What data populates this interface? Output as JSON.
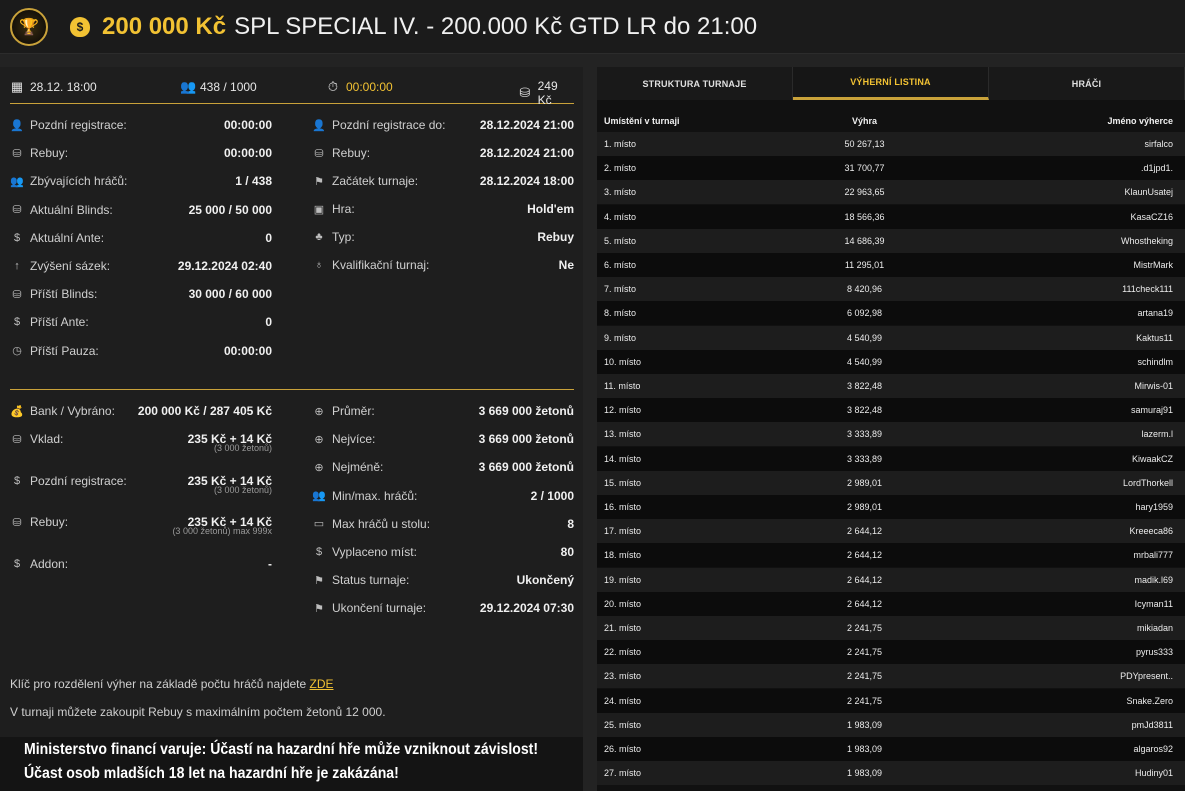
{
  "header": {
    "amount": "200 000 Kč",
    "title": "SPL SPECIAL IV. - 200.000 Kč GTD LR do 21:00",
    "moneybag_icon": "money-bag-icon"
  },
  "topbar": {
    "date": "28.12. 18:00",
    "players": "438 / 1000",
    "timer": "00:00:00",
    "buyin": "249 Kč"
  },
  "info_left": [
    {
      "icon": "user-clock-icon",
      "glyph": "👤",
      "label": "Pozdní registrace:",
      "value": "00:00:00"
    },
    {
      "icon": "chips-icon",
      "glyph": "⛁",
      "label": "Rebuy:",
      "value": "00:00:00"
    },
    {
      "icon": "users-icon",
      "glyph": "👥",
      "label": "Zbývajících hráčů:",
      "value": "1 / 438"
    },
    {
      "icon": "chips-icon",
      "glyph": "⛁",
      "label": "Aktuální Blinds:",
      "value": "25 000 / 50 000"
    },
    {
      "icon": "coin-icon",
      "glyph": "$",
      "label": "Aktuální Ante:",
      "value": "0"
    },
    {
      "icon": "arrow-up-icon",
      "glyph": "↑",
      "label": "Zvýšení sázek:",
      "value": "29.12.2024 02:40"
    },
    {
      "icon": "chips-icon",
      "glyph": "⛁",
      "label": "Příští Blinds:",
      "value": "30 000 / 60 000"
    },
    {
      "icon": "coin-icon",
      "glyph": "$",
      "label": "Příští Ante:",
      "value": "0"
    },
    {
      "icon": "clock-icon",
      "glyph": "◷",
      "label": "Příští Pauza:",
      "value": "00:00:00"
    }
  ],
  "info_right": [
    {
      "icon": "user-clock-icon",
      "glyph": "👤",
      "label": "Pozdní registrace do:",
      "value": "28.12.2024 21:00"
    },
    {
      "icon": "chips-icon",
      "glyph": "⛁",
      "label": "Rebuy:",
      "value": "28.12.2024 21:00"
    },
    {
      "icon": "flag-icon",
      "glyph": "⚑",
      "label": "Začátek turnaje:",
      "value": "28.12.2024 18:00"
    },
    {
      "icon": "game-icon",
      "glyph": "▣",
      "label": "Hra:",
      "value": "Hold'em"
    },
    {
      "icon": "suits-icon",
      "glyph": "♣",
      "label": "Typ:",
      "value": "Rebuy"
    },
    {
      "icon": "medal-icon",
      "glyph": "♁",
      "label": "Kvalifikační turnaj:",
      "value": "Ne"
    }
  ],
  "money_left": [
    {
      "icon": "money-bag-icon",
      "glyph": "💰",
      "label": "Bank / Vybráno:",
      "value": "200 000 Kč / 287 405 Kč",
      "sub": "",
      "gold": true
    },
    {
      "icon": "chips-icon",
      "glyph": "⛁",
      "label": "Vklad:",
      "value": "235 Kč + 14 Kč",
      "sub": "(3 000 žetonů)",
      "gold": false
    },
    {
      "icon": "coin-icon",
      "glyph": "$",
      "label": "Pozdní registrace:",
      "value": "235 Kč + 14 Kč",
      "sub": "(3 000 žetonů)",
      "gold": false
    },
    {
      "icon": "chips-icon",
      "glyph": "⛁",
      "label": "Rebuy:",
      "value": "235 Kč + 14 Kč",
      "sub": "(3 000 žetonů) max 999x",
      "gold": false
    },
    {
      "icon": "coin-icon",
      "glyph": "$",
      "label": "Addon:",
      "value": "-",
      "sub": "",
      "gold": false
    }
  ],
  "money_right": [
    {
      "icon": "plus-circle-icon",
      "glyph": "⊕",
      "label": "Průměr:",
      "value": "3 669 000 žetonů"
    },
    {
      "icon": "plus-circle-icon",
      "glyph": "⊕",
      "label": "Nejvíce:",
      "value": "3 669 000 žetonů"
    },
    {
      "icon": "plus-circle-icon",
      "glyph": "⊕",
      "label": "Nejméně:",
      "value": "3 669 000 žetonů"
    },
    {
      "icon": "users-icon",
      "glyph": "👥",
      "label": "Min/max. hráčů:",
      "value": "2 / 1000"
    },
    {
      "icon": "table-icon",
      "glyph": "▭",
      "label": "Max hráčů u stolu:",
      "value": "8"
    },
    {
      "icon": "coin-icon",
      "glyph": "$",
      "label": "Vyplaceno míst:",
      "value": "80"
    },
    {
      "icon": "flag-icon",
      "glyph": "⚑",
      "label": "Status turnaje:",
      "value": "Ukončený"
    },
    {
      "icon": "flag-icon",
      "glyph": "⚑",
      "label": "Ukončení turnaje:",
      "value": "29.12.2024 07:30"
    }
  ],
  "notes": {
    "key_text": "Klíč pro rozdělení výher na základě počtu hráčů najdete ",
    "key_link": "ZDE",
    "rebuy_text": "V turnaji můžete zakoupit Rebuy s maximálním počtem žetonů 12 000."
  },
  "warning": {
    "line1": "Ministerstvo financí varuje: Účastí na hazardní hře může vzniknout závislost!",
    "line2": "Účast osob mladších 18 let na hazardní hře je zakázána!"
  },
  "tabs": [
    "STRUKTURA TURNAJE",
    "VÝHERNÍ LISTINA",
    "HRÁČI"
  ],
  "table": {
    "headers": [
      "Umístění v turnaji",
      "Výhra",
      "Jméno výherce"
    ],
    "rows": [
      [
        "1. místo",
        "50 267,13",
        "sirfalco"
      ],
      [
        "2. místo",
        "31 700,77",
        ".d1jpd1."
      ],
      [
        "3. místo",
        "22 963,65",
        "KlaunUsatej"
      ],
      [
        "4. místo",
        "18 566,36",
        "KasaCZ16"
      ],
      [
        "5. místo",
        "14 686,39",
        "Whostheking"
      ],
      [
        "6. místo",
        "11 295,01",
        "MistrMark"
      ],
      [
        "7. místo",
        "8 420,96",
        "111check111"
      ],
      [
        "8. místo",
        "6 092,98",
        "artana19"
      ],
      [
        "9. místo",
        "4 540,99",
        "Kaktus11"
      ],
      [
        "10. místo",
        "4 540,99",
        "schindlm"
      ],
      [
        "11. místo",
        "3 822,48",
        "Mirwis-01"
      ],
      [
        "12. místo",
        "3 822,48",
        "samuraj91"
      ],
      [
        "13. místo",
        "3 333,89",
        "lazerm.l"
      ],
      [
        "14. místo",
        "3 333,89",
        "KiwaakCZ"
      ],
      [
        "15. místo",
        "2 989,01",
        "LordThorkell"
      ],
      [
        "16. místo",
        "2 989,01",
        "hary1959"
      ],
      [
        "17. místo",
        "2 644,12",
        "Kreeeca86"
      ],
      [
        "18. místo",
        "2 644,12",
        "mrbali777"
      ],
      [
        "19. místo",
        "2 644,12",
        "madik.l69"
      ],
      [
        "20. místo",
        "2 644,12",
        "Icyman11"
      ],
      [
        "21. místo",
        "2 241,75",
        "mikiadan"
      ],
      [
        "22. místo",
        "2 241,75",
        "pyrus333"
      ],
      [
        "23. místo",
        "2 241,75",
        "PDYpresent.."
      ],
      [
        "24. místo",
        "2 241,75",
        "Snake.Zero"
      ],
      [
        "25. místo",
        "1 983,09",
        "pmJd3811"
      ],
      [
        "26. místo",
        "1 983,09",
        "algaros92"
      ],
      [
        "27. místo",
        "1 983,09",
        "Hudiny01"
      ]
    ]
  }
}
